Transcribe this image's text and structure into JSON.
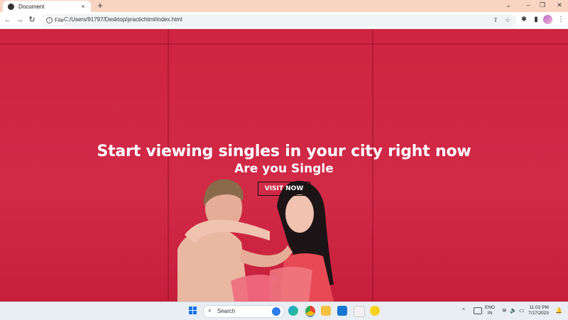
{
  "browser": {
    "tab_title": "Document",
    "tab_close": "×",
    "new_tab": "+",
    "win_minimize": "⌄",
    "win_min": "–",
    "win_max": "❐",
    "win_close": "✕",
    "back": "←",
    "forward": "→",
    "reload": "↻",
    "chip_label": "File",
    "url": "C:/Users/91797/Desktop/practichtml/index.html",
    "share": "⇪",
    "star": "☆",
    "extensions": "✱",
    "sidepanel": "▮",
    "menu": "⋮"
  },
  "hero": {
    "headline": "Start viewing singles in your city right now",
    "subline": "Are you Single",
    "cta": "VISIT NOW"
  },
  "taskbar": {
    "search_label": "Search",
    "search_icon": "⌕",
    "chevron": "^",
    "lang_line1": "ENG",
    "lang_line2": "IN",
    "wifi": "≋",
    "volume": "🔈",
    "battery": "▭",
    "time": "11:02 PM",
    "date": "7/17/2023",
    "notify": "🔔"
  },
  "colors": {
    "page_red": "#d12a47",
    "tab_strip": "#f9d4c2",
    "taskbar": "#e9eef4"
  }
}
